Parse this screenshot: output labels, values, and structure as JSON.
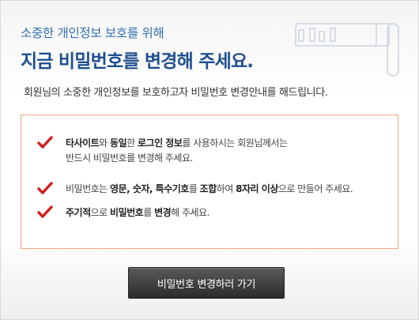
{
  "header": {
    "subtitle": "소중한 개인정보 보호를 위해",
    "title": "지금 비밀번호를 변경해 주세요."
  },
  "description": "회원님의 소중한 개인정보를 보호하고자 비밀번호 변경안내를 해드립니다.",
  "notice_items": [
    {
      "seg": [
        "타사이트",
        "와 ",
        "동일",
        "한 ",
        "로그인 정보",
        "를 사용하시는 회원님께서는"
      ],
      "line2": "반드시 비밀번호를 변경해 주세요."
    },
    {
      "seg": [
        "비밀번호는 ",
        "영문, 숫자, 특수기호",
        "를 ",
        "조합",
        "하여 ",
        "8자리 이상",
        "으로 만들어 주세요."
      ]
    },
    {
      "seg": [
        "주기적",
        "으로 ",
        "비밀번호",
        "를 ",
        "변경",
        "해 주세요."
      ]
    }
  ],
  "button": {
    "label": "비밀번호 변경하러 가기"
  },
  "icons": {
    "key": "key-icon",
    "check": "checkmark-icon"
  },
  "colors": {
    "title": "#1f4f8f",
    "subtitle": "#2f6fb0",
    "check": "#d21f1f",
    "box_border": "#f1a27d",
    "button": "#3a3a3a"
  }
}
